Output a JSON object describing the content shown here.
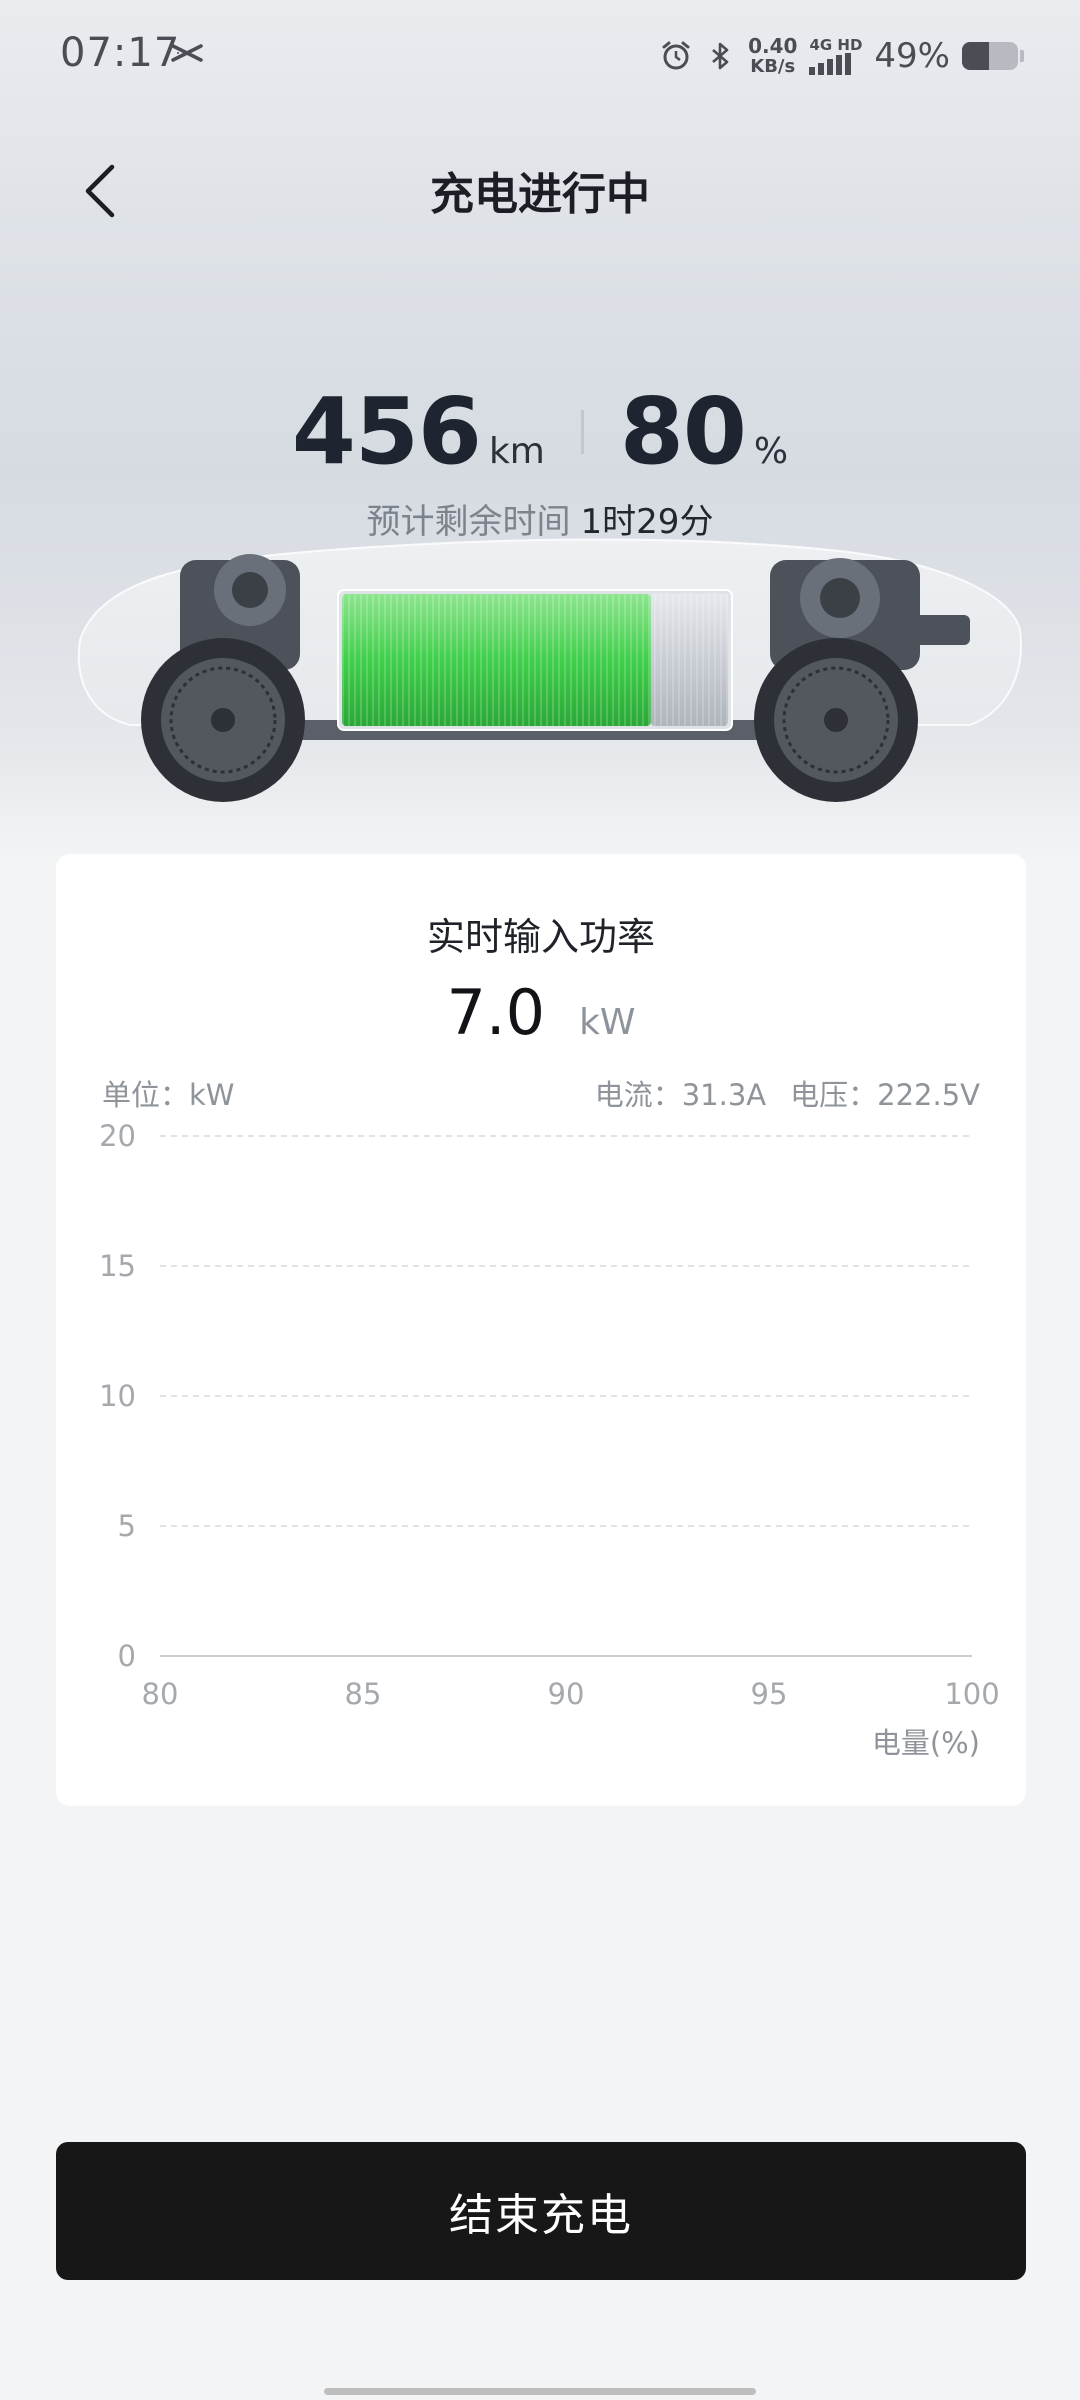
{
  "status_bar": {
    "time": "07:17",
    "net_speed_value": "0.40",
    "net_speed_unit": "KB/s",
    "network_type": "4G HD",
    "battery_percent": "49%",
    "battery_level": 0.49
  },
  "header": {
    "title": "充电进行中"
  },
  "summary": {
    "range_value": "456",
    "range_unit": "km",
    "soc_value": "80",
    "soc_unit": "%",
    "eta_label": "预计剩余时间",
    "eta_value": "1时29分",
    "battery_fill_fraction": 0.8
  },
  "power_card": {
    "title": "实时输入功率",
    "power_value": "7.0",
    "power_unit": "kW",
    "unit_label": "单位：kW",
    "current_label": "电流：31.3A",
    "voltage_label": "电压：222.5V",
    "x_axis_title": "电量(%)"
  },
  "chart_data": {
    "type": "line",
    "title": "实时输入功率",
    "xlabel": "电量(%)",
    "ylabel": "单位：kW",
    "x_ticks": [
      "80",
      "85",
      "90",
      "95",
      "100"
    ],
    "y_ticks": [
      "20",
      "15",
      "10",
      "5",
      "0"
    ],
    "xlim": [
      80,
      100
    ],
    "ylim": [
      0,
      20
    ],
    "grid": true,
    "series": []
  },
  "actions": {
    "end_charging_label": "结束充电"
  },
  "colors": {
    "battery_green": "#3fcf4a",
    "button_bg": "#171717",
    "card_bg": "#ffffff"
  }
}
